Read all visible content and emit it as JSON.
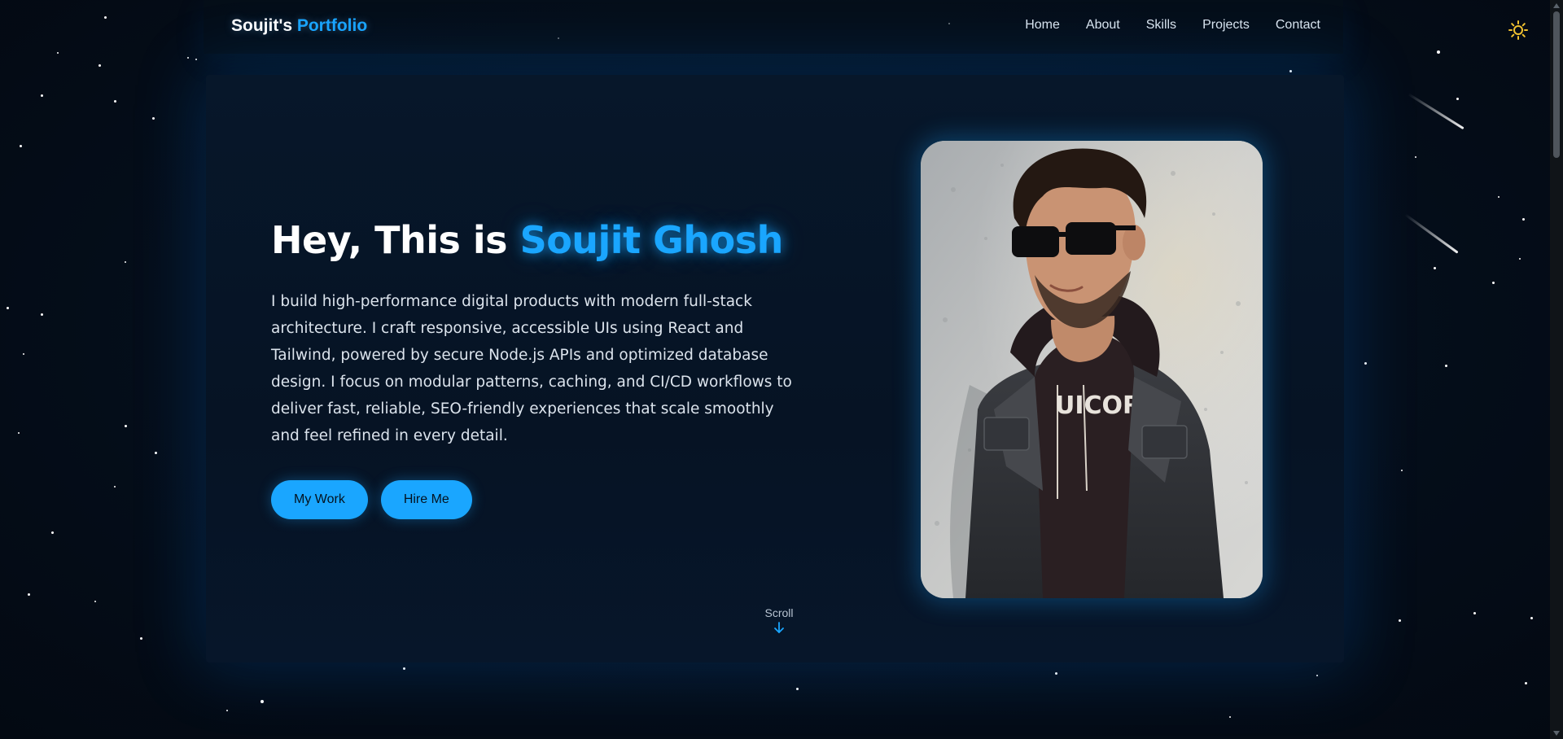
{
  "navbar": {
    "logo_primary": "Soujit's",
    "logo_accent": "Portfolio",
    "links": [
      {
        "label": "Home"
      },
      {
        "label": "About"
      },
      {
        "label": "Skills"
      },
      {
        "label": "Projects"
      },
      {
        "label": "Contact"
      }
    ],
    "theme_toggle_icon": "sun-icon"
  },
  "hero": {
    "title_prefix": "Hey, This is",
    "title_name": "Soujit Ghosh",
    "description": "I build high-performance digital products with modern full-stack architecture. I craft responsive, accessible UIs using React and Tailwind, powered by secure Node.js APIs and optimized database design. I focus on modular patterns, caching, and CI/CD workflows to deliver fast, reliable, SEO-friendly experiences that scale smoothly and feel refined in every detail.",
    "buttons": {
      "work_label": "My Work",
      "hire_label": "Hire Me"
    },
    "scroll_label": "Scroll",
    "scroll_icon": "arrow-down-icon",
    "portrait_alt": "Portrait photo"
  },
  "colors": {
    "accent": "#1aa6ff",
    "background": "#040b14",
    "card": "#07172a",
    "sun": "#f2c230"
  }
}
